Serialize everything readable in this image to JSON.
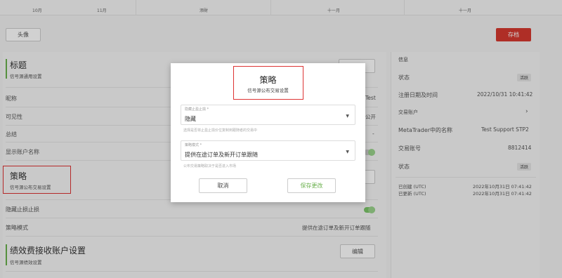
{
  "top_axis": {
    "labels": [
      "10月",
      "11月",
      "添財",
      "十一月",
      "十一月"
    ]
  },
  "header": {
    "avatar_button": "头像",
    "save_button": "存档"
  },
  "left": {
    "title_section": {
      "title": "标题",
      "subtitle": "信号源通用设置"
    },
    "rows": [
      {
        "label": "昵称",
        "value": "Test"
      },
      {
        "label": "可见性",
        "value": "公开"
      },
      {
        "label": "总结",
        "value": "-"
      },
      {
        "label": "显示账户名称",
        "value": ""
      }
    ],
    "strategy_section": {
      "title": "策略",
      "subtitle": "信号源公布交易设置"
    },
    "strategy_rows": [
      {
        "label": "隐藏止损止损",
        "value": ""
      },
      {
        "label": "策略模式",
        "value": "提供在途订单及新开订单跟随"
      }
    ],
    "fee_section": {
      "title": "绩效费接收账户设置",
      "subtitle": "信号源绩效设置",
      "edit_button": "编辑"
    }
  },
  "right": {
    "heading": "信息",
    "status_label": "状态",
    "status_badge": "活跃",
    "registered_label": "注册日期及时间",
    "registered_value": "2022/10/31 10:41:42",
    "trading_account_label": "交易账户",
    "mt_name_label": "MetaTrader中的名称",
    "mt_name_value": "Test Support STP2",
    "account_no_label": "交易账号",
    "account_no_value": "8812414",
    "status2_label": "状态",
    "status2_badge": "活跃",
    "created_label": "已创建 (UTC)",
    "created_value": "2022年10月31日 07:41:42",
    "updated_label": "已更新 (UTC)",
    "updated_value": "2022年10月31日 07:41:42"
  },
  "modal": {
    "title": "策略",
    "subtitle": "信号源公布交易设置",
    "field1": {
      "label": "隐藏止盈止损 *",
      "value": "隐藏",
      "help": "选择是否将止盈止损价位复制到跟随者的交易中"
    },
    "field2": {
      "label": "策略模式 *",
      "value": "提供在途订单及新开订单跟随",
      "help": "公布交易策略取决于是否进入市场"
    },
    "cancel": "取消",
    "save": "保存更改"
  },
  "colors": {
    "accent_red": "#d6392f",
    "accent_green": "#6ab04c",
    "highlight_box": "#dd3333"
  }
}
